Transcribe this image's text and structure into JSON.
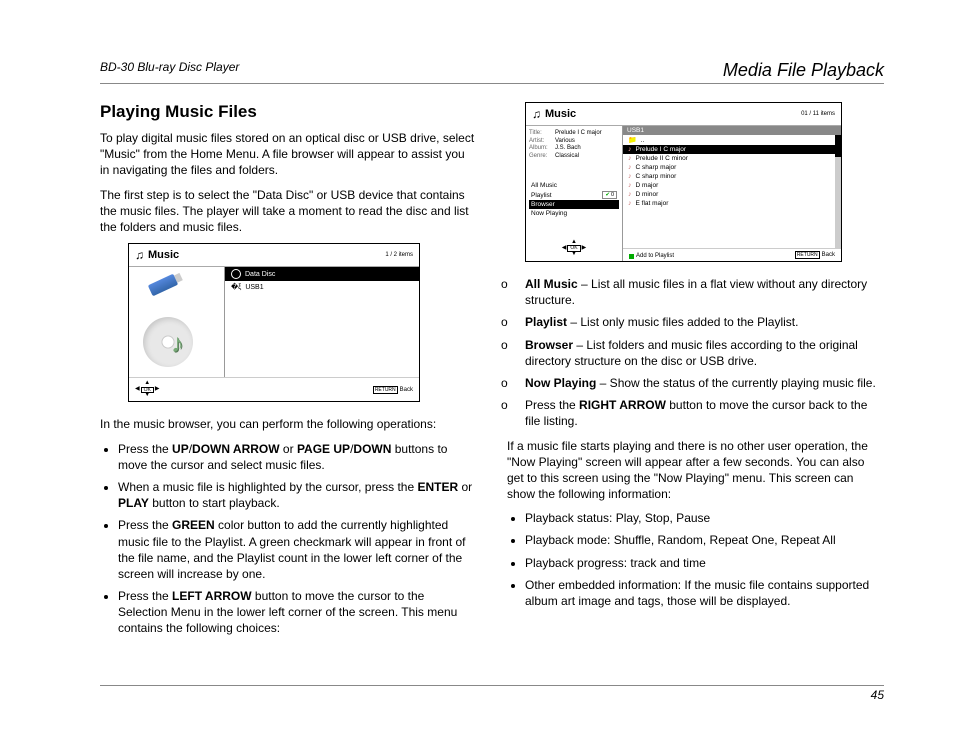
{
  "header": {
    "left": "BD-30 Blu-ray Disc Player",
    "right": "Media File Playback"
  },
  "section_title": "Playing Music Files",
  "para1": "To play digital music files stored on an optical disc or USB drive, select \"Music\" from the Home Menu. A file browser will appear to assist you in navigating the files and folders.",
  "para2": "The first step is to select the \"Data Disc\" or USB device that contains the music files. The player will take a moment to read the disc and list the folders and music files.",
  "ui1": {
    "title": "Music",
    "counter": "1 / 2 items",
    "rows": [
      "Data Disc",
      "USB1"
    ],
    "ok": "OK",
    "return": "RETURN",
    "back": "Back"
  },
  "para3": "In the music browser, you can perform the following operations:",
  "bullets_left": {
    "b1a": "Press the ",
    "b1b": "UP",
    "b1c": "/",
    "b1d": "DOWN ARROW",
    "b1e": " or ",
    "b1f": "PAGE UP",
    "b1g": "/",
    "b1h": "DOWN",
    "b1i": " buttons to move the cursor and select music files.",
    "b2a": "When a music file is highlighted by the cursor, press the ",
    "b2b": "ENTER",
    "b2c": " or ",
    "b2d": "PLAY",
    "b2e": " button to start playback.",
    "b3a": "Press the ",
    "b3b": "GREEN",
    "b3c": " color button to add the currently highlighted music file to the Playlist. A green checkmark will appear in front of the file name, and the Playlist count in the lower left corner of the screen will increase by one.",
    "b4a": "Press the ",
    "b4b": "LEFT ARROW",
    "b4c": " button to move the cursor to the Selection Menu in the lower left corner of the screen. This menu contains the following choices:"
  },
  "ui2": {
    "title": "Music",
    "counter": "01 / 11 items",
    "meta": {
      "title_label": "Title:",
      "title": "Prelude I C major",
      "artist_label": "Artist:",
      "artist": "Various",
      "album_label": "Album:",
      "album": "J.S. Bach",
      "genre_label": "Genre:",
      "genre": "Classical"
    },
    "menu": {
      "all": "All Music",
      "playlist": "Playlist",
      "playlist_count": "0",
      "browser": "Browser",
      "now": "Now Playing"
    },
    "crumb": "USB1",
    "up": "..",
    "files": [
      "Prelude I C major",
      "Prelude II C minor",
      "C sharp major",
      "C sharp minor",
      "D major",
      "D minor",
      "E flat major"
    ],
    "ok": "OK",
    "add": "Add to Playlist",
    "return": "RETURN",
    "back": "Back"
  },
  "circles": {
    "c1a": "All Music",
    "c1b": " – List all music files in a flat view without any directory structure.",
    "c2a": "Playlist",
    "c2b": " – List only music files added to the Playlist.",
    "c3a": "Browser",
    "c3b": " – List folders and music files according to the original directory structure on the disc or USB drive.",
    "c4a": "Now Playing",
    "c4b": " – Show the status of the currently playing music file.",
    "c5a": "Press the ",
    "c5b": "RIGHT ARROW",
    "c5c": " button to move the cursor back to the file listing."
  },
  "para4": "If a music file starts playing and there is no other user operation, the \"Now Playing\" screen will appear after a few seconds. You can also get to this screen using the \"Now Playing\" menu. This screen can show the following information:",
  "bullets_right": {
    "r1": "Playback status: Play, Stop, Pause",
    "r2": "Playback mode: Shuffle, Random, Repeat One, Repeat All",
    "r3": "Playback progress: track and time",
    "r4": "Other embedded information: If the music file contains supported album art image and tags, those will be displayed."
  },
  "page_number": "45"
}
